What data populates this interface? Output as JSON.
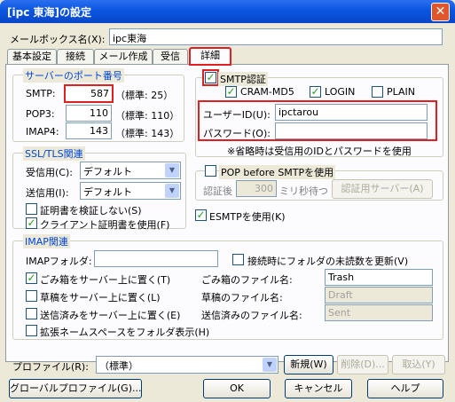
{
  "window": {
    "title": "[ipc 東海]の設定",
    "close_glyph": "✕"
  },
  "mailbox": {
    "label": "メールボックス名(X):",
    "value": "ipc東海"
  },
  "tabs": [
    {
      "label": "基本設定"
    },
    {
      "label": "接続"
    },
    {
      "label": "メール作成"
    },
    {
      "label": "受信"
    },
    {
      "label": "詳細"
    }
  ],
  "ports": {
    "legend": "サーバーのポート番号",
    "smtp": {
      "label": "SMTP:",
      "value": "587",
      "default": "（標準: 25）"
    },
    "pop3": {
      "label": "POP3:",
      "value": "110",
      "default": "（標準: 110）"
    },
    "imap4": {
      "label": "IMAP4:",
      "value": "143",
      "default": "（標準: 143）"
    }
  },
  "smtp_auth": {
    "label": "SMTP認証",
    "cram_md5": "CRAM-MD5",
    "login": "LOGIN",
    "plain": "PLAIN",
    "user_id_label": "ユーザーID(U):",
    "user_id_value": "ipctarou",
    "password_label": "パスワード(O):",
    "password_value": "",
    "note": "※省略時は受信用のIDとパスワードを使用"
  },
  "ssl": {
    "legend": "SSL/TLS関連",
    "recv_label": "受信用(C):",
    "recv_value": "デフォルト",
    "send_label": "送信用(I):",
    "send_value": "デフォルト",
    "no_verify": "証明書を検証しない(S)",
    "client_cert": "クライアント証明書を使用(F)"
  },
  "pop_before_smtp": {
    "label": "POP before SMTPを使用",
    "after_label": "認証後",
    "wait_value": "300",
    "wait_unit": "ミリ秒待つ",
    "server_button": "認証用サーバー(A)"
  },
  "esmtp": {
    "label": "ESMTPを使用(K)"
  },
  "imap": {
    "legend": "IMAP関連",
    "folder_label": "IMAPフォルダ:",
    "folder_value": "",
    "update_unread": "接続時にフォルダの未読数を更新(V)",
    "trash_on_server": "ごみ箱をサーバー上に置く(T)",
    "trash_name_label": "ごみ箱のファイル名:",
    "trash_name_value": "Trash",
    "drafts_on_server": "草稿をサーバー上に置く(L)",
    "drafts_name_label": "草稿のファイル名:",
    "drafts_name_value": "Draft",
    "sent_on_server": "送信済みをサーバー上に置く(E)",
    "sent_name_label": "送信済みのファイル名:",
    "sent_name_value": "Sent",
    "extended_namespace": "拡張ネームスペースをフォルダ表示(H)"
  },
  "profile": {
    "label": "プロファイル(R):",
    "value": "（標準）",
    "new_button": "新規(W)",
    "delete_button": "削除(D)...",
    "cancel_button": "取込(Y)"
  },
  "footer": {
    "global_profile_button": "グローバルプロファイル(G)...",
    "ok_button": "OK",
    "cancel_button": "キャンセル",
    "help_button": "ヘルプ"
  },
  "colors": {
    "title_bar": "#0a56e0",
    "highlight_box": "#e02020",
    "group_legend": "#0046d5"
  }
}
